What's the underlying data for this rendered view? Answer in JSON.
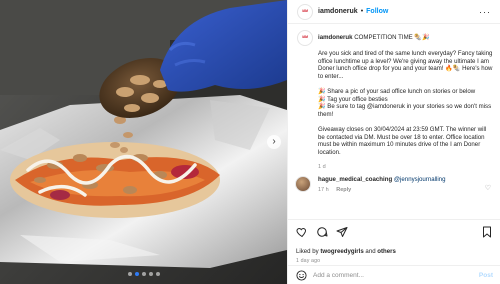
{
  "photo": {
    "carousel_dots": 5,
    "active_dot": 1,
    "next_arrow": "chevron-right-icon"
  },
  "header": {
    "avatar_logo": "ᴵᴬᴹ",
    "username": "iamdoneruk",
    "separator": "•",
    "follow_label": "Follow",
    "more": "···"
  },
  "caption": {
    "username": "iamdoneruk",
    "title": "COMPETITION TIME 🌯🎉",
    "intro": "Are you sick and tired of the same lunch everyday? Fancy taking office lunchtime up a level? We're giving away the ultimate I am Doner lunch office drop for you and your team! 🔥🌯 Here's how to enter...",
    "steps": [
      "🎉 Share a pic of your sad office lunch on stories or below",
      "🎉 Tag your office besties",
      "🎉 Be sure to tag @iamdoneruk in your stories so we don't miss them!"
    ],
    "terms": "Giveaway closes on 30/04/2024 at 23:59 GMT. The winner will be contacted via DM. Must be over 18 to enter. Office location must be within maximum 10 minutes drive of the I am Doner location.",
    "time": "1 d"
  },
  "comment": {
    "username": "hague_medical_coaching",
    "text": "@jennysjournalling",
    "time": "17 h",
    "reply_label": "Reply"
  },
  "actions": {
    "liked_by_prefix": "Liked by ",
    "liked_by_user": "twogreedygirls",
    "liked_by_and": " and ",
    "liked_by_others": "others",
    "ago": "1 day ago"
  },
  "add_comment": {
    "placeholder": "Add a comment...",
    "post_label": "Post"
  },
  "colors": {
    "accent": "#0095f6",
    "post_disabled": "#b3dbff",
    "glove": "#2b4fb8"
  }
}
